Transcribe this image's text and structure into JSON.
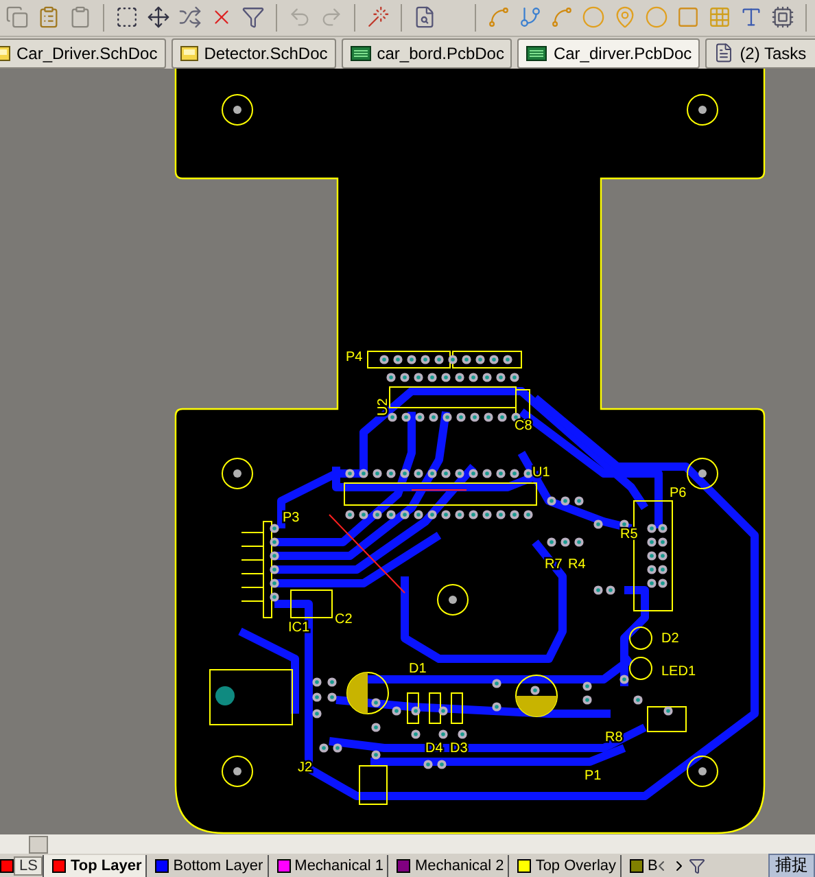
{
  "document_tabs": [
    {
      "label": "Car_Driver.SchDoc",
      "kind": "sch",
      "selected": false
    },
    {
      "label": "Detector.SchDoc",
      "kind": "sch",
      "selected": false
    },
    {
      "label": "car_bord.PcbDoc",
      "kind": "pcb",
      "selected": false
    },
    {
      "label": "Car_dirver.PcbDoc",
      "kind": "pcb",
      "selected": true
    },
    {
      "label": "(2) Tasks",
      "kind": "tasks",
      "selected": false
    }
  ],
  "designators": [
    "P4",
    "U2",
    "C8",
    "U1",
    "P3",
    "IC1",
    "C2",
    "D1",
    "D2",
    "LED1",
    "D3",
    "D4",
    "R4",
    "R7",
    "R5",
    "R8",
    "P6",
    "J2",
    "P1"
  ],
  "layer_bar": {
    "ls_button": {
      "label": "LS",
      "color": "#ff0000"
    },
    "layers": [
      {
        "label": "Top Layer",
        "color": "#ff0000",
        "selected": true
      },
      {
        "label": "Bottom Layer",
        "color": "#0000ff",
        "selected": false
      },
      {
        "label": "Mechanical 1",
        "color": "#ff00ff",
        "selected": false
      },
      {
        "label": "Mechanical 2",
        "color": "#800080",
        "selected": false
      },
      {
        "label": "Top Overlay",
        "color": "#ffff00",
        "selected": false
      },
      {
        "label": "B",
        "color": "#808000",
        "selected": false
      }
    ],
    "snap_button": "捕捉"
  }
}
